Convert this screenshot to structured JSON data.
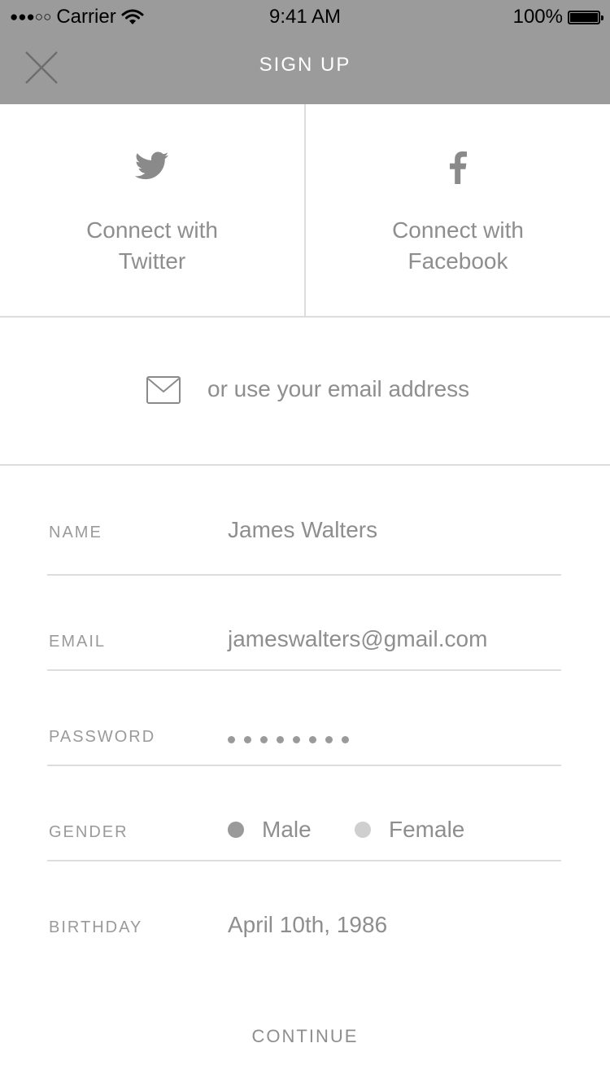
{
  "status_bar": {
    "signal": "●●●○○",
    "carrier": "Carrier",
    "time": "9:41 AM",
    "battery": "100%"
  },
  "nav": {
    "title": "SIGN UP",
    "close_icon": "close-icon"
  },
  "social": {
    "twitter": {
      "line1": "Connect with",
      "line2": "Twitter",
      "icon": "twitter-icon"
    },
    "facebook": {
      "line1": "Connect with",
      "line2": "Facebook",
      "icon": "facebook-icon"
    }
  },
  "email_option": {
    "text": "or use your email address",
    "icon": "mail-icon"
  },
  "form": {
    "name": {
      "label": "NAME",
      "value": "James Walters"
    },
    "email": {
      "label": "EMAIL",
      "value": "jameswalters@gmail.com"
    },
    "password": {
      "label": "PASSWORD",
      "length": 8
    },
    "gender": {
      "label": "GENDER",
      "options": [
        {
          "label": "Male",
          "selected": true
        },
        {
          "label": "Female",
          "selected": false
        }
      ]
    },
    "birthday": {
      "label": "BIRTHDAY",
      "value": "April 10th, 1986"
    }
  },
  "continue_label": "CONTINUE",
  "colors": {
    "header_bg": "#9b9b9b",
    "text": "#8e8e8e",
    "divider": "#dddddd",
    "radio_selected": "#9a9a9a",
    "radio_unselected": "#cfcfcf"
  }
}
